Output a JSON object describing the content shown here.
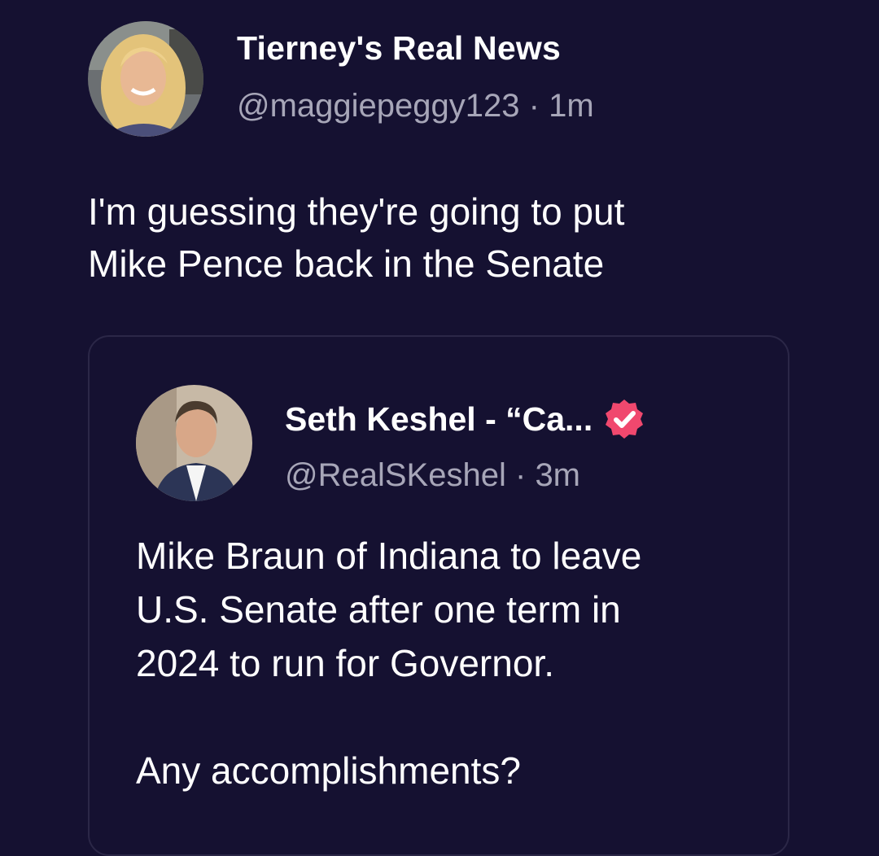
{
  "post": {
    "author_name": "Tierney's Real News",
    "author_handle": "@maggiepeggy123",
    "separator": "·",
    "time": "1m",
    "text": "I'm guessing they're going to put\nMike Pence back in the Senate",
    "avatar_icon": "profile-photo-woman-blonde"
  },
  "quoted_post": {
    "author_name": "Seth Keshel - “Ca...",
    "author_handle": "@RealSKeshel",
    "separator": "·",
    "time": "3m",
    "verified_icon": "verified-badge-icon",
    "verified_color": "#f0486e",
    "text": "Mike Braun of Indiana to leave\nU.S. Senate after one term in\n2024 to run for Governor.\n\nAny accomplishments?",
    "avatar_icon": "profile-photo-man-suit"
  },
  "colors": {
    "background": "#151131",
    "text": "#ffffff",
    "muted_text": "#a7a6b8",
    "card_border": "#2b2747"
  }
}
